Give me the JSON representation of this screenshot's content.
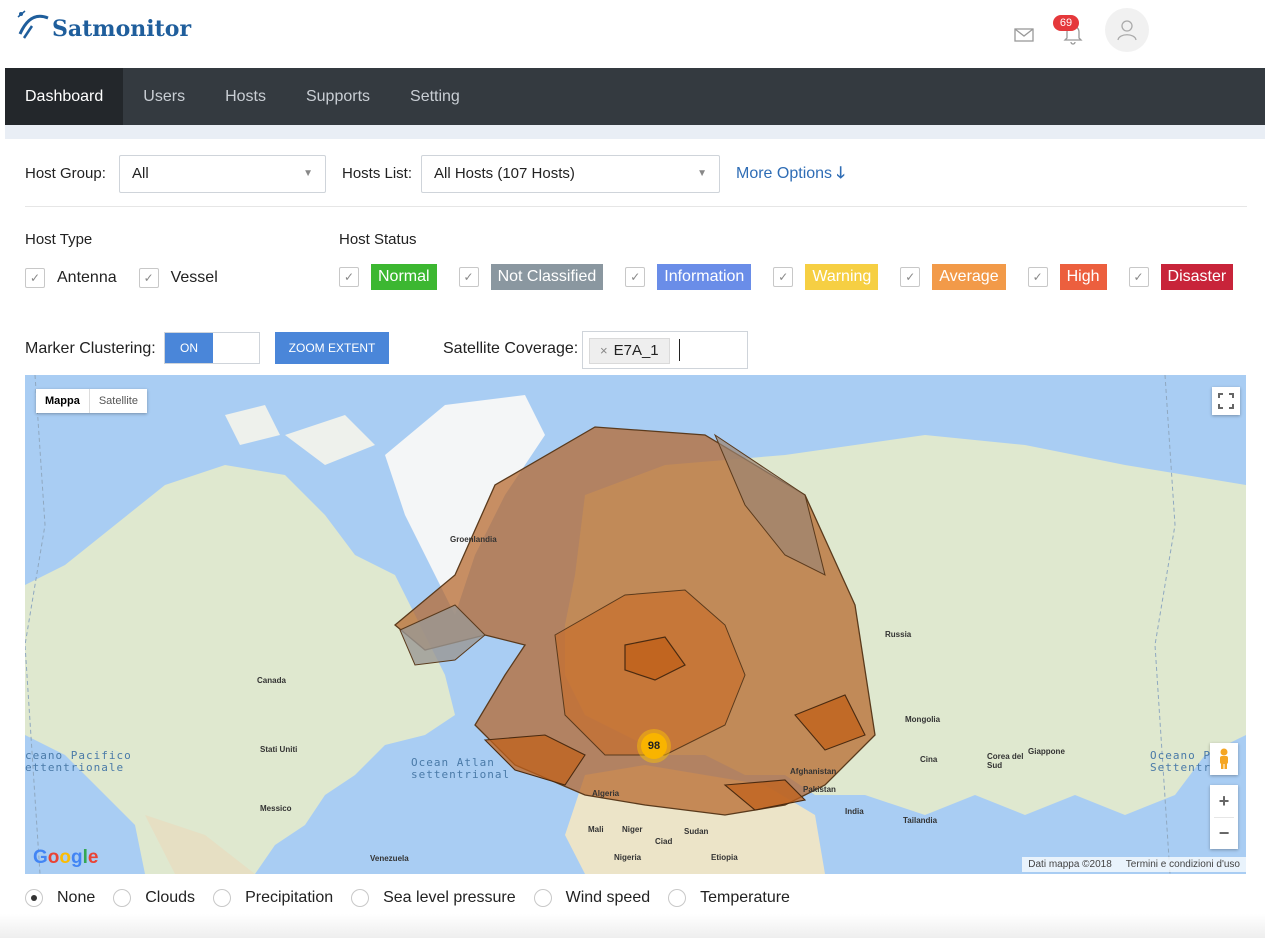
{
  "app": {
    "title": "Satmonitor"
  },
  "header": {
    "notification_count": "69"
  },
  "nav": {
    "items": [
      {
        "label": "Dashboard",
        "active": true
      },
      {
        "label": "Users"
      },
      {
        "label": "Hosts"
      },
      {
        "label": "Supports"
      },
      {
        "label": "Setting"
      }
    ]
  },
  "filters": {
    "host_group_label": "Host Group:",
    "host_group_value": "All",
    "hosts_list_label": "Hosts List:",
    "hosts_list_value": "All Hosts (107 Hosts)",
    "more_options": "More Options"
  },
  "host_type": {
    "label": "Host Type",
    "options": [
      {
        "label": "Antenna",
        "checked": true
      },
      {
        "label": "Vessel",
        "checked": true
      }
    ]
  },
  "host_status": {
    "label": "Host Status",
    "options": [
      {
        "label": "Normal",
        "color": "#3cb731",
        "checked": true
      },
      {
        "label": "Not Classified",
        "color": "#8a97a0",
        "checked": true
      },
      {
        "label": "Information",
        "color": "#6a8de8",
        "checked": true
      },
      {
        "label": "Warning",
        "color": "#f6cf43",
        "checked": true
      },
      {
        "label": "Average",
        "color": "#f29a49",
        "checked": true
      },
      {
        "label": "High",
        "color": "#ec5f3e",
        "checked": true
      },
      {
        "label": "Disaster",
        "color": "#c8243a",
        "checked": true
      }
    ]
  },
  "controls": {
    "marker_clustering_label": "Marker Clustering:",
    "toggle_state": "ON",
    "zoom_extent": "ZOOM EXTENT",
    "satellite_coverage_label": "Satellite Coverage:",
    "coverage_chip": "E7A_1"
  },
  "map": {
    "type_selected": "Mappa",
    "type_other": "Satellite",
    "cluster_count": "98",
    "attribution": "Dati mappa ©2018",
    "terms": "Termini e condizioni d'uso",
    "labels": {
      "groenlandia": "Groenlandia",
      "canada": "Canada",
      "stati_uniti": "Stati Uniti",
      "messico": "Messico",
      "venezuela": "Venezuela",
      "russia": "Russia",
      "mongolia": "Mongolia",
      "cina": "Cina",
      "corea": "Corea del Sud",
      "giappone": "Giappone",
      "india": "India",
      "tailandia": "Tailandia",
      "pakistan": "Pakistan",
      "afghanistan": "Afghanistan",
      "algeria": "Algeria",
      "mali": "Mali",
      "niger": "Niger",
      "ciad": "Ciad",
      "sudan": "Sudan",
      "nigeria": "Nigeria",
      "etiopia": "Etiopia",
      "ocean_left_1": "ceano Pacifico",
      "ocean_left_2": "ettentrionale",
      "ocean_mid_1": "Ocean Atlan",
      "ocean_mid_2": "settentrional",
      "ocean_right_1": "Oceano Paci",
      "ocean_right_2": "Settentr"
    }
  },
  "weather_layers": [
    {
      "label": "None",
      "selected": true
    },
    {
      "label": "Clouds"
    },
    {
      "label": "Precipitation"
    },
    {
      "label": "Sea level pressure"
    },
    {
      "label": "Wind speed"
    },
    {
      "label": "Temperature"
    }
  ]
}
